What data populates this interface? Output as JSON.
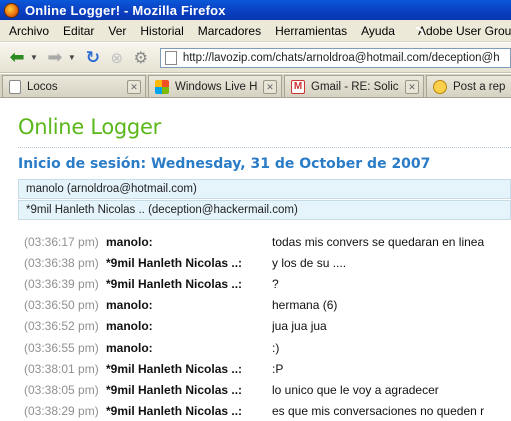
{
  "window": {
    "title": "Online Logger! - Mozilla Firefox"
  },
  "menu": {
    "items": [
      "Archivo",
      "Editar",
      "Ver",
      "Historial",
      "Marcadores",
      "Herramientas",
      "Ayuda"
    ],
    "bookmark_label": "Adobe User Group C"
  },
  "nav": {
    "url": "http://lavozip.com/chats/arnoldroa@hotmail.com/deception@h"
  },
  "tabs": [
    {
      "label": "Locos",
      "icon": "page-icon"
    },
    {
      "label": "Windows Live H...",
      "icon": "windows-live-icon"
    },
    {
      "label": "Gmail - RE: Solici...",
      "icon": "gmail-icon"
    },
    {
      "label": "Post a rep",
      "icon": "yahoo-icon"
    }
  ],
  "page": {
    "app_title": "Online Logger",
    "session_heading": "Inicio de sesión: Wednesday, 31 de October de 2007",
    "participants": [
      "manolo (arnoldroa@hotmail.com)",
      "*9mil Hanleth Nicolas .. (deception@hackermail.com)"
    ],
    "messages": [
      {
        "time": "(03:36:17 pm)",
        "sender": "manolo:",
        "text": "todas mis convers se quedaran en linea"
      },
      {
        "time": "(03:36:38 pm)",
        "sender": "*9mil Hanleth Nicolas ..:",
        "text": "y los de su ...."
      },
      {
        "time": "(03:36:39 pm)",
        "sender": "*9mil Hanleth Nicolas ..:",
        "text": "?"
      },
      {
        "time": "(03:36:50 pm)",
        "sender": "manolo:",
        "text": "hermana (6)"
      },
      {
        "time": "(03:36:52 pm)",
        "sender": "manolo:",
        "text": "jua jua jua"
      },
      {
        "time": "(03:36:55 pm)",
        "sender": "manolo:",
        "text": ":)"
      },
      {
        "time": "(03:38:01 pm)",
        "sender": "*9mil Hanleth Nicolas ..:",
        "text": ":P"
      },
      {
        "time": "(03:38:05 pm)",
        "sender": "*9mil Hanleth Nicolas ..:",
        "text": "lo unico que le voy a agradecer"
      },
      {
        "time": "(03:38:29 pm)",
        "sender": "*9mil Hanleth Nicolas ..:",
        "text": "es que mis conversaciones no queden r"
      }
    ]
  },
  "colors": {
    "accent_green": "#5bb81a",
    "heading_blue": "#2a7cc7",
    "participant_bg": "#e5f4fb"
  }
}
